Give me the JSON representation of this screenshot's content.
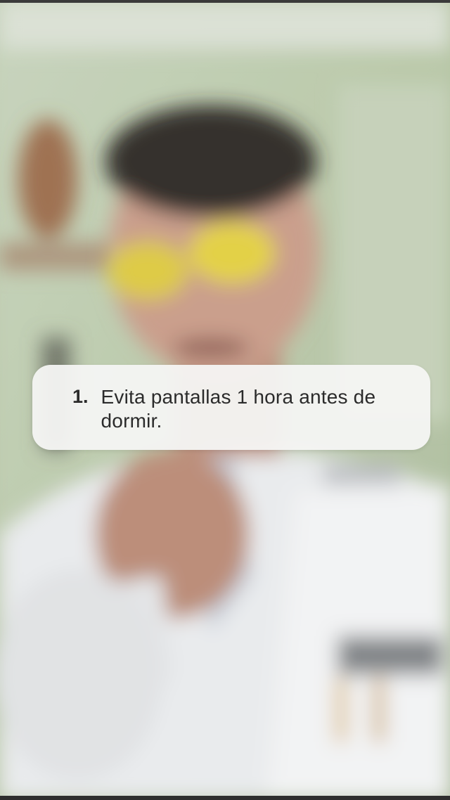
{
  "overlay": {
    "number": "1.",
    "text": "Evita pantallas 1 hora antes de dormir."
  },
  "scene": {
    "subject": "blurred-person-in-white-coat-with-yellow-glasses",
    "colors": {
      "wall": "#bccab0",
      "coat": "#e9ebee",
      "hair": "#2a2522",
      "skin": "#c89a86",
      "lens": "#e2cf3c"
    }
  }
}
